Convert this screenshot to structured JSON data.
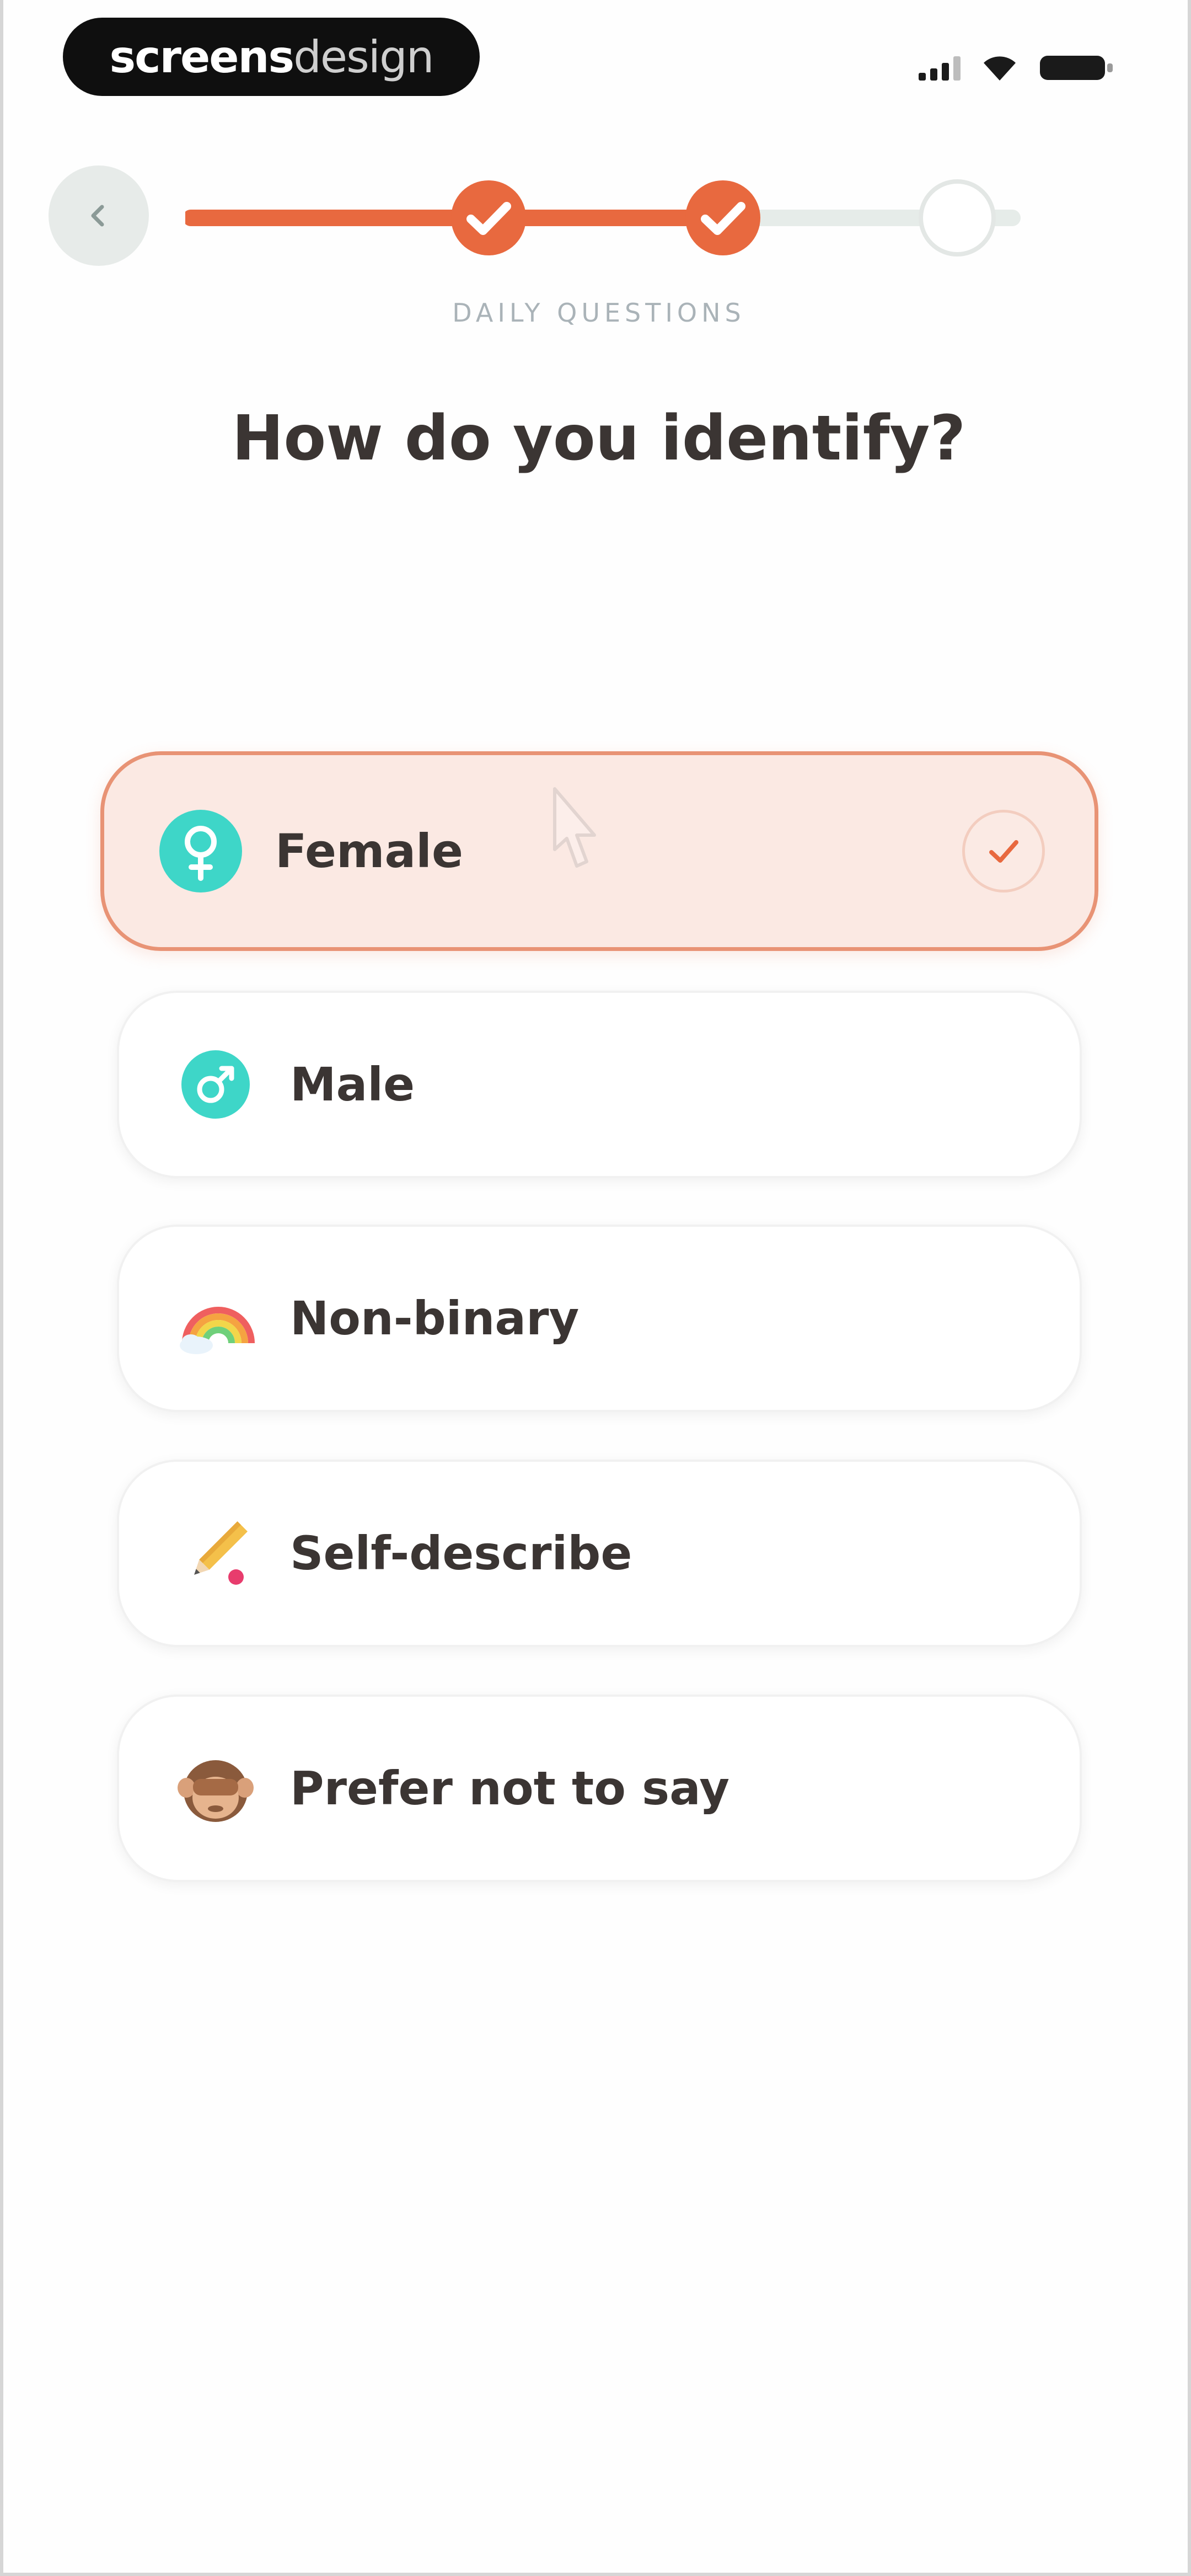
{
  "status_bar": {
    "brand_bold": "screens",
    "brand_light": "design",
    "signal_icon": "cellular-signal-icon",
    "wifi_icon": "wifi-icon",
    "battery_icon": "battery-icon"
  },
  "header": {
    "back_icon": "chevron-left-icon",
    "progress": {
      "steps_total": 3,
      "steps_completed": 2,
      "completed_icon": "check-icon"
    },
    "eyebrow": "DAILY QUESTIONS"
  },
  "question": "How do you identify?",
  "options": [
    {
      "label": "Female",
      "icon": "female-symbol-icon",
      "selected": true
    },
    {
      "label": "Male",
      "icon": "male-symbol-icon",
      "selected": false
    },
    {
      "label": "Non-binary",
      "icon": "rainbow-icon",
      "selected": false
    },
    {
      "label": "Self-describe",
      "icon": "pencil-icon",
      "selected": false
    },
    {
      "label": "Prefer not to say",
      "icon": "see-no-evil-monkey-icon",
      "selected": false
    }
  ],
  "colors": {
    "accent": "#e8693f",
    "accent_light": "#fbe9e3",
    "teal": "#3ed6c8",
    "track": "#e6ece9",
    "text": "#3b3533",
    "muted": "#aab3b8"
  }
}
